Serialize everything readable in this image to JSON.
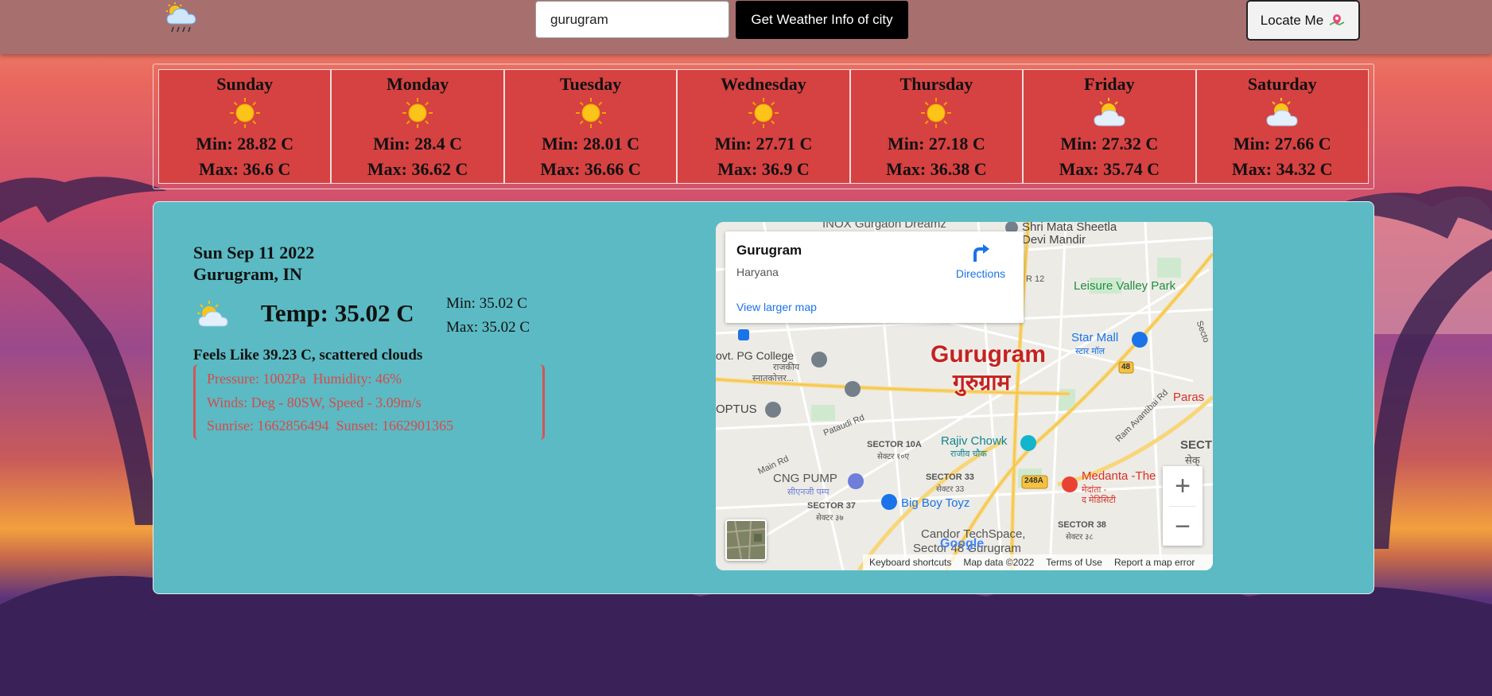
{
  "header": {
    "logo_icon": "cloud-sun-rain-icon",
    "search": {
      "value": "gurugram"
    },
    "get_button_label": "Get Weather Info of city",
    "locate_button_label": "Locate Me",
    "locate_icon": "map-pin-icon"
  },
  "forecast": [
    {
      "day": "Sunday",
      "icon": "sun-icon",
      "min": "Min: 28.82 C",
      "max": "Max: 36.6 C"
    },
    {
      "day": "Monday",
      "icon": "sun-icon",
      "min": "Min: 28.4 C",
      "max": "Max: 36.62 C"
    },
    {
      "day": "Tuesday",
      "icon": "sun-icon",
      "min": "Min: 28.01 C",
      "max": "Max: 36.66 C"
    },
    {
      "day": "Wednesday",
      "icon": "sun-icon",
      "min": "Min: 27.71 C",
      "max": "Max: 36.9 C"
    },
    {
      "day": "Thursday",
      "icon": "sun-icon",
      "min": "Min: 27.18 C",
      "max": "Max: 36.38 C"
    },
    {
      "day": "Friday",
      "icon": "partly-cloudy-icon",
      "min": "Min: 27.32 C",
      "max": "Max: 35.74 C"
    },
    {
      "day": "Saturday",
      "icon": "partly-cloudy-icon",
      "min": "Min: 27.66 C",
      "max": "Max: 34.32 C"
    }
  ],
  "current": {
    "date": "Sun Sep 11 2022",
    "place": "Gurugram, IN",
    "icon": "partly-cloudy-icon",
    "temp": "Temp: 35.02 C",
    "min": "Min: 35.02 C",
    "max": "Max: 35.02 C",
    "feels": "Feels Like 39.23 C, scattered clouds",
    "pressure": "Pressure: 1002Pa",
    "humidity": "Humidity: 46%",
    "winds": "Winds: Deg - 80SW, Speed - 3.09m/s",
    "sunrise": "Sunrise: 1662856494",
    "sunset": "Sunset: 1662901365"
  },
  "map": {
    "card": {
      "title": "Gurugram",
      "subtitle": "Haryana",
      "directions": "Directions",
      "larger_map": "View larger map"
    },
    "city_name": "Gurugram",
    "city_name_hi": "गुरुग्राम",
    "labels": {
      "inox": "INOX Gurgaon Dreamz",
      "shri_mata": "Shri Mata Sheetla",
      "devi_mandir": "Devi Mandir",
      "r12": "R 12",
      "leisure": "Leisure Valley Park",
      "star_mall": "Star Mall",
      "star_mall_hi": "स्टार मॉल",
      "sector_edge": "Secto",
      "pg_college": "ovt. PG College",
      "rajkiya": "राजकीय",
      "snatakottar": "स्नातकोत्तर...",
      "optus": "OPTUS",
      "pataudi": "Pataudi Rd",
      "sector10a": "SECTOR 10A",
      "sector10a_hi": "सेक्टर १०ए",
      "rajiv_chowk": "Rajiv Chowk",
      "rajiv_chowk_hi": "राजीव चौक",
      "ram_avantibai": "Ram Avantibai Rd",
      "paras": "Paras",
      "sect": "SECT",
      "sect_hi": "सेक्",
      "main_rd": "Main Rd",
      "cng_pump": "CNG PUMP",
      "cng_pump_hi": "सीएनजी पम्प",
      "sector33": "SECTOR 33",
      "sector33_hi": "सेक्टर 33",
      "medanta": "Medanta -The",
      "medanta_hi1": "मेदांता -",
      "medanta_hi2": "द मेडिसिटी",
      "big_boy": "Big Boy Toyz",
      "sector37": "SECTOR 37",
      "sector37_hi": "सेक्टर ३७",
      "sector38": "SECTOR 38",
      "sector38_hi": "सेक्टर ३८",
      "candor": "Candor TechSpace,",
      "sector48": "Sector 48 Gurugram",
      "shield48": "48",
      "shield248a": "248A"
    },
    "footer": {
      "shortcuts": "Keyboard shortcuts",
      "data": "Map data ©2022",
      "terms": "Terms of Use",
      "report": "Report a map error"
    },
    "google": "Google",
    "zoom_in": "+",
    "zoom_out": "−"
  }
}
